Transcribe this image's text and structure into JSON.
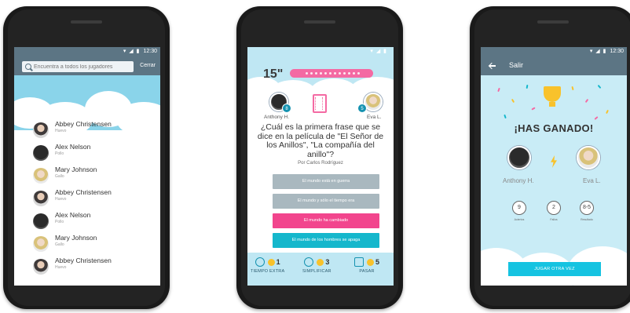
{
  "screen1": {
    "status_time": "12:30",
    "search_placeholder": "Encuentra a todos los jugadores",
    "close_label": "Cerrar",
    "players": [
      {
        "name": "Abbey Christensen",
        "sub": "Huevo",
        "avatar": "female-avatar"
      },
      {
        "name": "Alex Nelson",
        "sub": "Pollo",
        "avatar": "male-avatar"
      },
      {
        "name": "Mary Johnson",
        "sub": "Gallo",
        "avatar": "blonde-avatar"
      },
      {
        "name": "Abbey Christensen",
        "sub": "Huevo",
        "avatar": "female-avatar"
      },
      {
        "name": "Alex Nelson",
        "sub": "Pollo",
        "avatar": "male-avatar"
      },
      {
        "name": "Mary Johnson",
        "sub": "Gallo",
        "avatar": "blonde-avatar"
      },
      {
        "name": "Abbey Christensen",
        "sub": "Huevo",
        "avatar": "female-avatar"
      }
    ]
  },
  "screen2": {
    "timer": "15\"",
    "player_left": {
      "name": "Anthony H.",
      "badge": "8"
    },
    "player_right": {
      "name": "Eva L.",
      "badge": "5"
    },
    "question": "¿Cuál es la primera frase que se dice en la película de \"El Señor de los Anillos\", \"La compañía del anillo\"?",
    "author": "Por Carlos Rodríguez",
    "answers": [
      {
        "text": "El mundo está en guerra",
        "color": "#a9b8bf"
      },
      {
        "text": "El mundo y sólo el tiempo era",
        "color": "#a9b8bf"
      },
      {
        "text": "El mundo ha cambiado",
        "color": "#f2458d"
      },
      {
        "text": "El mundo de los hombres se apaga",
        "color": "#15b7cc"
      }
    ],
    "bottom": [
      {
        "label": "TIEMPO EXTRA",
        "count": "1"
      },
      {
        "label": "SIMPLIFICAR",
        "count": "3"
      },
      {
        "label": "PASAR",
        "count": "5"
      }
    ]
  },
  "screen3": {
    "status_time": "12:30",
    "exit_label": "Salir",
    "title": "¡HAS GANADO!",
    "player_left": "Anthony H.",
    "player_right": "Eva L.",
    "stats": [
      {
        "value": "9",
        "label": "Aciertos"
      },
      {
        "value": "2",
        "label": "Fallos"
      },
      {
        "value": "8-5",
        "label": "Resultado"
      }
    ],
    "play_again": "JUGAR OTRA VEZ"
  }
}
